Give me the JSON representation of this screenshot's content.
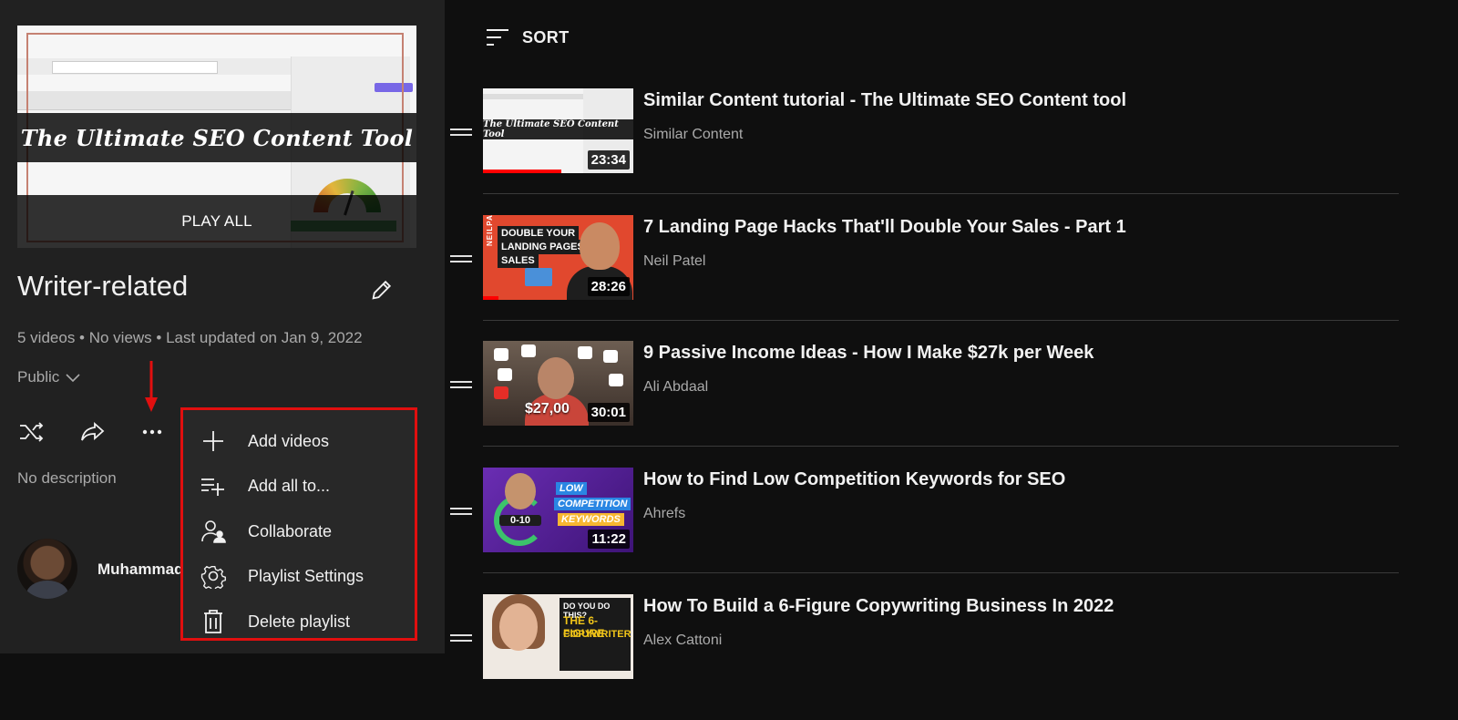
{
  "playlist": {
    "hero_title": "The Ultimate SEO Content Tool",
    "play_all_label": "PLAY ALL",
    "title": "Writer-related",
    "meta": "5 videos • No views • Last updated on Jan 9, 2022",
    "privacy": "Public",
    "description": "No description",
    "owner": "Muhammad"
  },
  "menu": {
    "items": [
      {
        "label": "Add videos",
        "icon": "plus-icon"
      },
      {
        "label": "Add all to...",
        "icon": "playlist-add-icon"
      },
      {
        "label": "Collaborate",
        "icon": "collaborate-icon"
      },
      {
        "label": "Playlist Settings",
        "icon": "gear-icon"
      },
      {
        "label": "Delete playlist",
        "icon": "trash-icon"
      }
    ]
  },
  "sort": {
    "label": "SORT"
  },
  "videos": [
    {
      "title": "Similar Content tutorial - The Ultimate SEO Content tool",
      "channel": "Similar Content",
      "duration": "23:34",
      "thumb_text": "The Ultimate SEO Content Tool",
      "watched_fraction": 0.52
    },
    {
      "title": "7 Landing Page Hacks That'll Double Your Sales - Part 1",
      "channel": "Neil Patel",
      "duration": "28:26",
      "thumb_lines": [
        "DOUBLE YOUR",
        "LANDING PAGES",
        "SALES"
      ],
      "thumb_side": "NEILPATEL",
      "watched_fraction": 0.1
    },
    {
      "title": "9 Passive Income Ideas - How I Make $27k per Week",
      "channel": "Ali Abdaal",
      "duration": "30:01",
      "thumb_text": "$27,00",
      "watched_fraction": 0
    },
    {
      "title": "How to Find Low Competition Keywords for SEO",
      "channel": "Ahrefs",
      "duration": "11:22",
      "thumb_lines": [
        "LOW",
        "COMPETITION",
        "KEYWORDS"
      ],
      "thumb_num": "0-10",
      "watched_fraction": 0
    },
    {
      "title": "How To Build a 6-Figure Copywriting Business In 2022",
      "channel": "Alex Cattoni",
      "thumb_lines": [
        "DO YOU DO THIS?",
        "THE 6-FIGURE",
        "COPYWRITER"
      ],
      "watched_fraction": 0
    }
  ],
  "colors": {
    "background": "#0f0f0f",
    "panel": "#212121",
    "menu_border": "#e10f0f",
    "progress": "#ff0000"
  }
}
